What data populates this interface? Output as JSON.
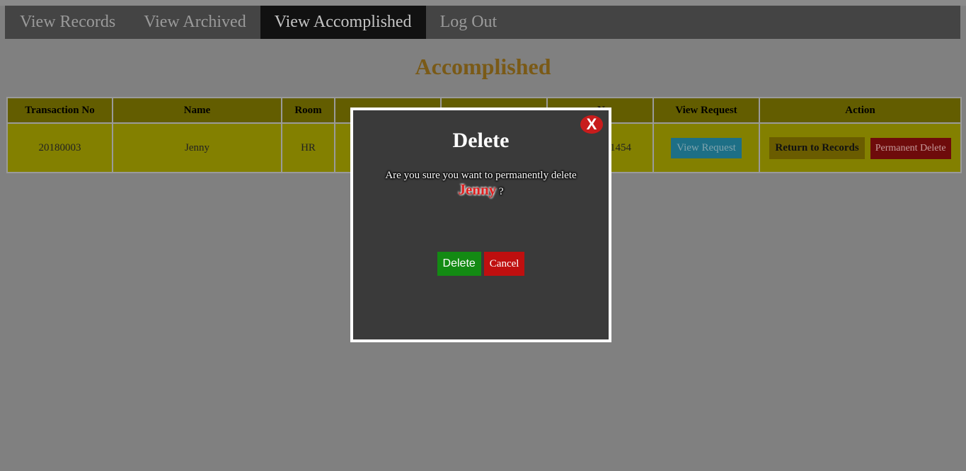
{
  "nav": {
    "items": [
      {
        "label": "View Records",
        "active": false
      },
      {
        "label": "View Archived",
        "active": false
      },
      {
        "label": "View Accomplished",
        "active": true
      },
      {
        "label": "Log Out",
        "active": false
      }
    ]
  },
  "page": {
    "title": "Accomplished"
  },
  "table": {
    "headers": [
      "Transaction No",
      "Name",
      "Room",
      "",
      "",
      "e No",
      "View Request",
      "Action"
    ],
    "rows": [
      {
        "transaction_no": "20180003",
        "name": "Jenny",
        "room": "HR",
        "col4": "",
        "col5": "",
        "col6": "1454",
        "view_request_label": "View Request",
        "return_label": "Return to Records",
        "permanent_delete_label": "Permanent Delete"
      }
    ]
  },
  "modal": {
    "close_label": "X",
    "title": "Delete",
    "message": "Are you sure you want to permanently delete",
    "target_name": "Jenny",
    "question_mark": "?",
    "delete_label": "Delete",
    "cancel_label": "Cancel"
  },
  "colors": {
    "overlay_bg": "#808080",
    "header_bg": "#635d00",
    "row_bg": "#838000",
    "modal_bg": "#3a3a3a",
    "delete_green": "#138a13",
    "cancel_red": "#bf0f0f",
    "title_color": "#7a5a17"
  }
}
